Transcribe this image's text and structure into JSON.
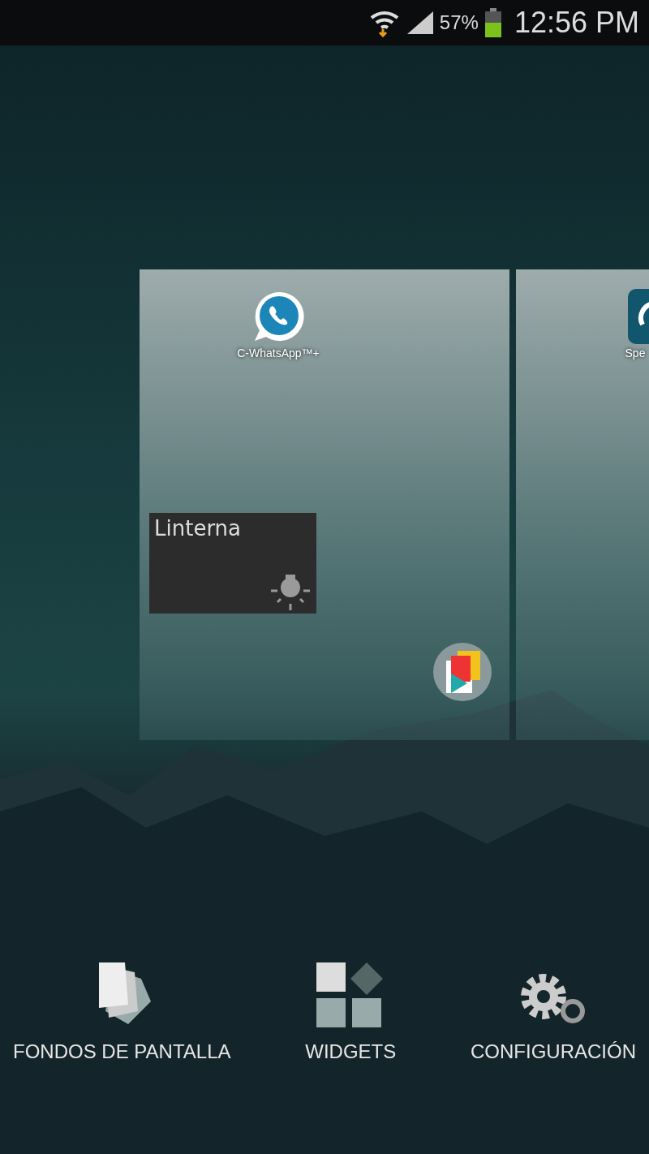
{
  "status_bar": {
    "battery_percent": "57%",
    "time": "12:56 PM"
  },
  "home_pages": [
    {
      "apps": [
        {
          "label": "C-WhatsApp™+",
          "kind": "chat"
        }
      ],
      "widgets": [
        {
          "title": "Linterna",
          "kind": "flashlight"
        }
      ]
    },
    {
      "apps": [
        {
          "label": "Spe",
          "kind": "gauge"
        }
      ]
    }
  ],
  "menu": [
    {
      "label": "FONDOS DE PANTALLA",
      "kind": "wallpapers"
    },
    {
      "label": "WIDGETS",
      "kind": "widgets"
    },
    {
      "label": "CONFIGURACIÓN",
      "kind": "settings"
    }
  ]
}
